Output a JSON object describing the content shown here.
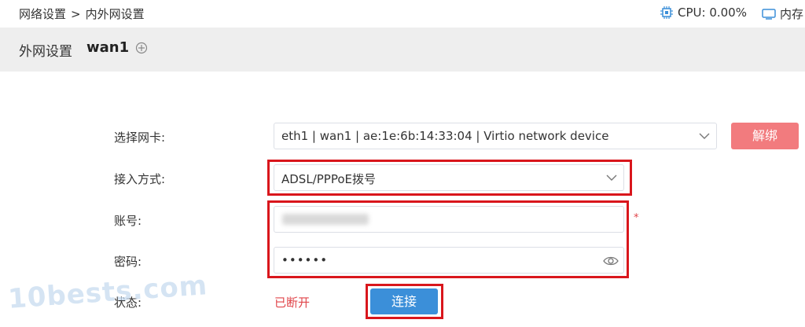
{
  "topbar": {
    "breadcrumb": {
      "parent": "网络设置",
      "separator": ">",
      "current": "内外网设置"
    },
    "cpu": {
      "icon": "cpu-icon",
      "label": "CPU: 0.00%"
    },
    "memory": {
      "icon": "memory-icon",
      "label": "内存"
    }
  },
  "header": {
    "title": "外网设置",
    "name": "wan1",
    "add_icon": "plus-circle-icon"
  },
  "form": {
    "nic": {
      "label": "选择网卡:",
      "value": "eth1 | wan1 | ae:1e:6b:14:33:04 | Virtio network device",
      "unbind_label": "解绑"
    },
    "access_mode": {
      "label": "接入方式:",
      "value": "ADSL/PPPoE拨号"
    },
    "account": {
      "label": "账号:",
      "value": "",
      "required_mark": "*"
    },
    "password": {
      "label": "密码:",
      "value": "••••••",
      "toggle_icon": "eye-icon"
    },
    "status": {
      "label": "状态:",
      "value": "已断开",
      "connect_label": "连接"
    }
  },
  "watermark": "10bests.com",
  "colors": {
    "highlight": "#d9161c",
    "unbind_button": "#f27b7e",
    "connect_button": "#3b8fd9",
    "status_disconnected": "#e0454a",
    "header_bg": "#eeeeee"
  }
}
